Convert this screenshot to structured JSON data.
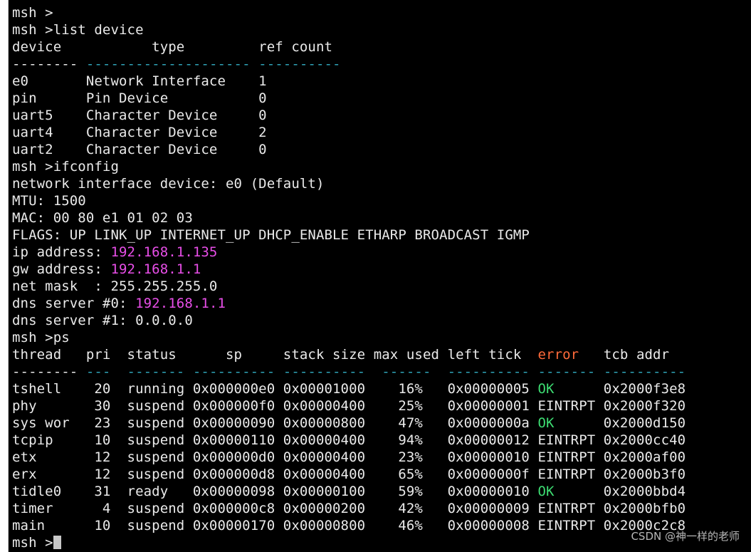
{
  "colors": {
    "background": "#000000",
    "text": "#eaeaea",
    "separator": "#2fa3b8",
    "ip_highlight": "#e84ee8",
    "ok": "#3ddc72",
    "error_header": "#ff6a3a"
  },
  "terminal": {
    "lines": [
      [
        {
          "text": "msh >"
        }
      ],
      [
        {
          "text": "msh >list device"
        }
      ],
      [
        {
          "text": "device           type         ref count"
        }
      ],
      [
        {
          "text": "-------- "
        },
        {
          "text": "-------------------- ----------",
          "c": "cyan"
        }
      ],
      [
        {
          "text": "e0       Network Interface    1"
        }
      ],
      [
        {
          "text": "pin      Pin Device           0"
        }
      ],
      [
        {
          "text": "uart5    Character Device     0"
        }
      ],
      [
        {
          "text": "uart4    Character Device     2"
        }
      ],
      [
        {
          "text": "uart2    Character Device     0"
        }
      ],
      [
        {
          "text": "msh >ifconfig"
        }
      ],
      [
        {
          "text": "network interface device: e0 (Default)"
        }
      ],
      [
        {
          "text": "MTU: 1500"
        }
      ],
      [
        {
          "text": "MAC: 00 80 e1 01 02 03"
        }
      ],
      [
        {
          "text": "FLAGS: UP LINK_UP INTERNET_UP DHCP_ENABLE ETHARP BROADCAST IGMP"
        }
      ],
      [
        {
          "text": "ip address: "
        },
        {
          "text": "192.168.1.135",
          "c": "magenta"
        }
      ],
      [
        {
          "text": "gw address: "
        },
        {
          "text": "192.168.1.1",
          "c": "magenta"
        }
      ],
      [
        {
          "text": "net mask  : 255.255.255.0"
        }
      ],
      [
        {
          "text": "dns server #0: "
        },
        {
          "text": "192.168.1.1",
          "c": "magenta"
        }
      ],
      [
        {
          "text": "dns server #1: 0.0.0.0"
        }
      ],
      [
        {
          "text": "msh >ps"
        }
      ],
      [
        {
          "text": "thread   pri  status      sp     stack size max used left tick  "
        },
        {
          "text": "error",
          "c": "orange"
        },
        {
          "text": "   tcb addr"
        }
      ],
      [
        {
          "text": "-------- "
        },
        {
          "text": "---  ------- ---------- ----------  ------  ---------- ------- ----------",
          "c": "cyan"
        }
      ],
      [
        {
          "text": "tshell    20  running 0x000000e0 0x00001000    16%   0x00000005 "
        },
        {
          "text": "OK",
          "c": "green"
        },
        {
          "text": "      0x2000f3e8"
        }
      ],
      [
        {
          "text": "phy       30  suspend 0x000000f0 0x00000400    25%   0x00000001 EINTRPT 0x2000f320"
        }
      ],
      [
        {
          "text": "sys wor   23  suspend 0x00000090 0x00000800    47%   0x0000000a "
        },
        {
          "text": "OK",
          "c": "green"
        },
        {
          "text": "      0x2000d150"
        }
      ],
      [
        {
          "text": "tcpip     10  suspend 0x00000110 0x00000400    94%   0x00000012 EINTRPT 0x2000cc40"
        }
      ],
      [
        {
          "text": "etx       12  suspend 0x000000d0 0x00000400    23%   0x00000010 EINTRPT 0x2000af00"
        }
      ],
      [
        {
          "text": "erx       12  suspend 0x000000d8 0x00000400    65%   0x0000000f EINTRPT 0x2000b3f0"
        }
      ],
      [
        {
          "text": "tidle0    31  ready   0x00000098 0x00000100    59%   0x00000010 "
        },
        {
          "text": "OK",
          "c": "green"
        },
        {
          "text": "      0x2000bbd4"
        }
      ],
      [
        {
          "text": "timer      4  suspend 0x000000c8 0x00000200    42%   0x00000009 EINTRPT 0x2000bfb0"
        }
      ],
      [
        {
          "text": "main      10  suspend 0x00000170 0x00000800    46%   0x00000008 EINTRPT 0x2000c2c8"
        }
      ],
      [
        {
          "text": "msh >"
        },
        {
          "cursor": true
        }
      ]
    ]
  },
  "watermark": "CSDN @神一样的老师"
}
